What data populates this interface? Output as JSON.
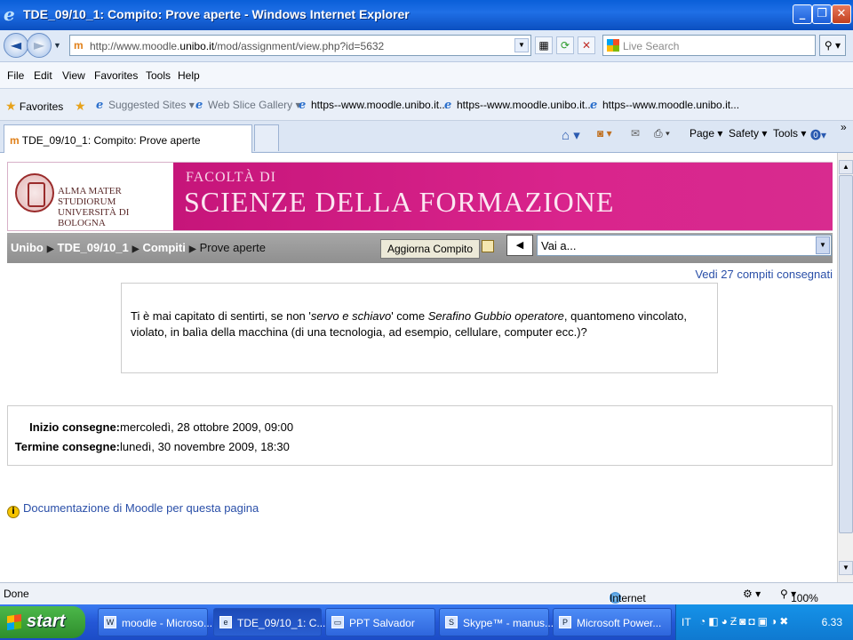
{
  "window": {
    "title": "TDE_09/10_1: Compito: Prove aperte - Windows Internet Explorer"
  },
  "address": {
    "url_prefix": "http://www.moodle.",
    "url_domain": "unibo.it",
    "url_suffix": "/mod/assignment/view.php?id=5632",
    "search_placeholder": "Live Search"
  },
  "menu": [
    "File",
    "Edit",
    "View",
    "Favorites",
    "Tools",
    "Help"
  ],
  "favorites": {
    "label": "Favorites",
    "items": [
      "Suggested Sites ▾",
      "Web Slice Gallery ▾",
      "https--www.moodle.unibo.it...",
      "https--www.moodle.unibo.it...",
      "https--www.moodle.unibo.it..."
    ]
  },
  "tab": {
    "title": "TDE_09/10_1: Compito: Prove aperte"
  },
  "commandbar": {
    "page": "Page ▾",
    "safety": "Safety ▾",
    "tools": "Tools ▾"
  },
  "banner": {
    "university_line1": "ALMA MATER STUDIORUM",
    "university_line2": "UNIVERSITÀ DI BOLOGNA",
    "faculty_line1": "FACOLTÀ DI",
    "faculty_line2": "SCIENZE DELLA FORMAZIONE"
  },
  "nav": {
    "breadcrumb": [
      "Unibo",
      "TDE_09/10_1",
      "Compiti",
      "Prove aperte"
    ],
    "update_button": "Aggiorna Compito",
    "jump_value": "Vai a..."
  },
  "assignment": {
    "submitted_link": "Vedi 27 compiti consegnati",
    "intro_1": "Ti è mai capitato di sentirti, se non '",
    "intro_em1": "servo e schiavo",
    "intro_2": "' come ",
    "intro_em2": "Serafino Gubbio operatore",
    "intro_3": ", quantomeno vincolato, violato, in balìa della macchina (di una tecnologia, ad esempio, cellulare, computer ecc.)?",
    "start_label": "Inizio consegne:",
    "start_value": "mercoledì, 28 ottobre 2009, 09:00",
    "end_label": "Termine consegne:",
    "end_value": "lunedì, 30 novembre 2009, 18:30",
    "doc_link": "Documentazione di Moodle per questa pagina"
  },
  "status": {
    "left": "Done",
    "zone": "Internet",
    "zoom": "100%"
  },
  "taskbar": {
    "start": "start",
    "tasks": [
      "moodle - Microso...",
      "TDE_09/10_1: C...",
      "PPT Salvador",
      "Skype™ - manus...",
      "Microsoft Power..."
    ],
    "lang": "IT",
    "clock": "6.33"
  }
}
